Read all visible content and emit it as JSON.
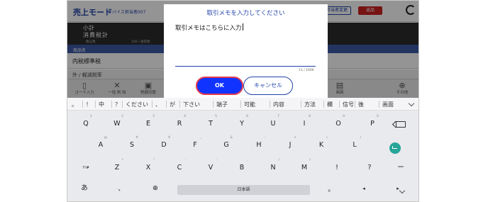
{
  "app": {
    "title": "売上モード",
    "subtitle": "デバイス担当者007",
    "header_buttons": [
      "",
      "担当者変更"
    ],
    "header_red_button": "返品"
  },
  "summary": {
    "subtotal_label": "小計",
    "tax_label": "消費税計",
    "tax_detail_label": "税込税",
    "count_text": "160 / 通常税"
  },
  "list": {
    "column_header": "商品名",
    "row1": "内税標準税",
    "row2": "外 / 軽減税率"
  },
  "toolbar": {
    "items": [
      {
        "label": "コード入力",
        "icon": "barcode-icon"
      },
      {
        "label": "一括 削 除",
        "icon": "close-icon"
      },
      {
        "label": "税額切替",
        "icon": "tax-icon"
      },
      {
        "label": "画面",
        "icon": "screen-icon"
      },
      {
        "label": "その他",
        "icon": "plus-icon"
      }
    ]
  },
  "dialog": {
    "title": "取引メモを入力してください",
    "memo_value": "取引メモはこちらに入力",
    "counter": "11 / 1000",
    "ok_label": "OK",
    "cancel_label": "キャンセル"
  },
  "keyboard": {
    "suggestions": [
      "。",
      "！",
      "中",
      "？",
      "ください",
      "、",
      "が",
      "下さい",
      "端子",
      "可能",
      "内容",
      "方法",
      "欄",
      "信号",
      "後",
      "画面"
    ],
    "row1": [
      {
        "k": "Q",
        "h": "1"
      },
      {
        "k": "W",
        "h": "2"
      },
      {
        "k": "E",
        "h": "3"
      },
      {
        "k": "R",
        "h": "4"
      },
      {
        "k": "T",
        "h": "5"
      },
      {
        "k": "Y",
        "h": "6"
      },
      {
        "k": "U",
        "h": "7"
      },
      {
        "k": "I",
        "h": "8"
      },
      {
        "k": "O",
        "h": "9"
      },
      {
        "k": "P",
        "h": "0"
      }
    ],
    "row2": [
      {
        "k": "A",
        "h": "@"
      },
      {
        "k": "S",
        "h": "#"
      },
      {
        "k": "D",
        "h": "¥"
      },
      {
        "k": "F",
        "h": "_"
      },
      {
        "k": "G",
        "h": "&"
      },
      {
        "k": "H",
        "h": "-"
      },
      {
        "k": "J",
        "h": "+"
      },
      {
        "k": "K",
        "h": "("
      },
      {
        "k": "L",
        "h": ")"
      }
    ],
    "row3": [
      {
        "k": "?!#",
        "h": ""
      },
      {
        "k": "Z",
        "h": "*"
      },
      {
        "k": "X",
        "h": "\""
      },
      {
        "k": "C",
        "h": "'"
      },
      {
        "k": "V",
        "h": ":"
      },
      {
        "k": "B",
        "h": ";"
      },
      {
        "k": "N",
        "h": "!"
      },
      {
        "k": "M",
        "h": "?"
      },
      {
        "k": "!",
        "h": ""
      },
      {
        "k": "?",
        "h": ""
      },
      {
        "k": "ー",
        "h": ""
      }
    ],
    "bottom": {
      "mode": "あ",
      "comma": "、",
      "globe": "⊕",
      "space_label": "日本語",
      "period": "。",
      "left": "◂",
      "right": "▸"
    }
  }
}
